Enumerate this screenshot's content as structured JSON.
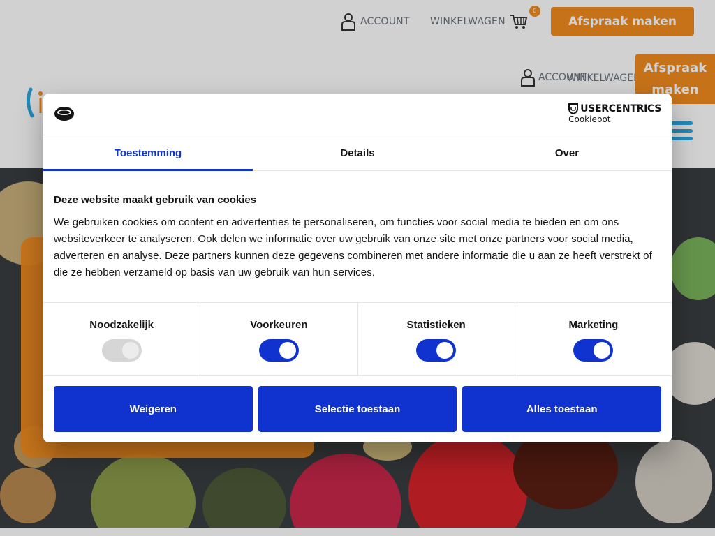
{
  "topbar": {
    "account_label": "ACCOUNT",
    "cart_label": "WINKELWAGEN",
    "cart_count": "0",
    "appointment_button": "Afspraak maken"
  },
  "header2": {
    "account_label": "ACCOUNT",
    "cart_label": "WINKELWAGEN",
    "appointment_button": "Afspraak maken"
  },
  "colors": {
    "orange": "#f28c1f",
    "primary_blue": "#1032cf",
    "menu_blue": "#2aa8e0"
  },
  "dialog": {
    "brand_name": "USERCENTRICS",
    "brand_sub": "Cookiebot",
    "tabs": [
      {
        "label": "Toestemming",
        "active": true
      },
      {
        "label": "Details",
        "active": false
      },
      {
        "label": "Over",
        "active": false
      }
    ],
    "title": "Deze website maakt gebruik van cookies",
    "description": "We gebruiken cookies om content en advertenties te personaliseren, om functies voor social media te bieden en om ons websiteverkeer te analyseren. Ook delen we informatie over uw gebruik van onze site met onze partners voor social media, adverteren en analyse. Deze partners kunnen deze gegevens combineren met andere informatie die u aan ze heeft verstrekt of die ze hebben verzameld op basis van uw gebruik van hun services.",
    "toggles": [
      {
        "label": "Noodzakelijk",
        "checked": true,
        "disabled": true
      },
      {
        "label": "Voorkeuren",
        "checked": true,
        "disabled": false
      },
      {
        "label": "Statistieken",
        "checked": true,
        "disabled": false
      },
      {
        "label": "Marketing",
        "checked": true,
        "disabled": false
      }
    ],
    "buttons": {
      "reject": "Weigeren",
      "allow_selection": "Selectie toestaan",
      "allow_all": "Alles toestaan"
    }
  }
}
